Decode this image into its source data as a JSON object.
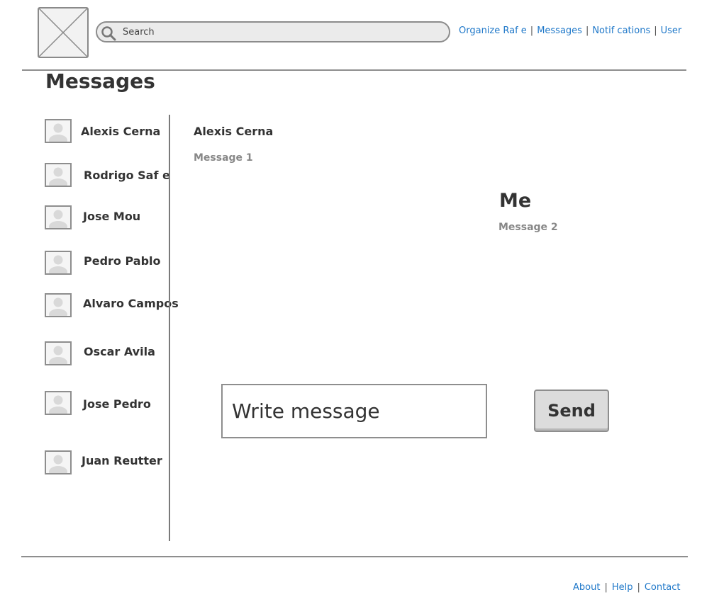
{
  "header": {
    "logo_icon": "image-placeholder-icon",
    "search": {
      "placeholder": "Search",
      "value": "",
      "icon": "search-icon"
    },
    "nav": [
      {
        "label": "Organize Raf  e"
      },
      {
        "label": "Messages"
      },
      {
        "label": "Notif cations"
      },
      {
        "label": "User"
      }
    ],
    "nav_separator": "|"
  },
  "page": {
    "title": "Messages"
  },
  "contacts": [
    {
      "name": "Alexis Cerna"
    },
    {
      "name": "Rodrigo Saf  e"
    },
    {
      "name": "Jose Mou"
    },
    {
      "name": "Pedro Pablo"
    },
    {
      "name": "Alvaro Campos"
    },
    {
      "name": "Oscar Avila"
    },
    {
      "name": "Jose Pedro"
    },
    {
      "name": "Juan Reutter"
    }
  ],
  "conversation": {
    "contact_name": "Alexis Cerna",
    "incoming_message": "Message 1",
    "me_label": "Me",
    "outgoing_message": "Message 2",
    "compose_placeholder": "Write message",
    "send_label": "Send"
  },
  "footer": {
    "links": [
      {
        "label": "About"
      },
      {
        "label": "Help"
      },
      {
        "label": "Contact"
      }
    ],
    "separator": "|"
  },
  "colors": {
    "link": "#1f78c9",
    "text": "#333333",
    "muted": "#888888",
    "border": "#8e8e8e",
    "button_bg": "#dcdcdc"
  }
}
